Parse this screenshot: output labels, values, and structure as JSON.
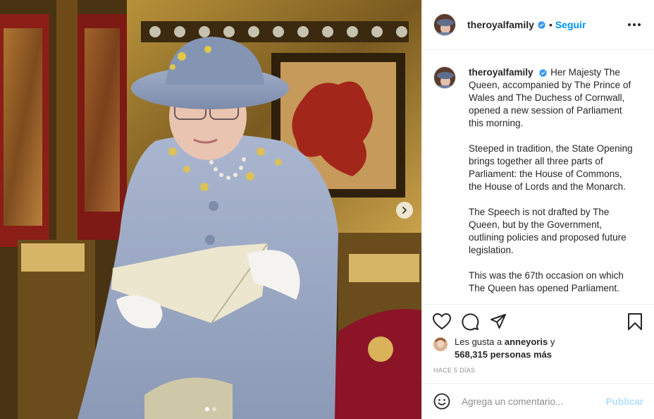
{
  "post": {
    "username": "theroyalfamily",
    "verified": true,
    "follow_label": "Seguir",
    "bullet": "•",
    "more_icon": "ellipsis-icon"
  },
  "caption": {
    "username": "theroyalfamily",
    "paragraphs": [
      "Her Majesty The Queen, accompanied by The Prince of Wales and The Duchess of Cornwall, opened a new session of Parliament this morning.",
      "Steeped in tradition, the State Opening brings together all three parts of Parliament: the House of Commons, the House of Lords and the Monarch.",
      "The Speech is not drafted by The Queen, but by the Government, outlining policies and proposed future legislation.",
      "This was the 67th occasion on which The Queen has opened Parliament."
    ]
  },
  "actions": {
    "like_icon": "heart-icon",
    "comment_icon": "comment-icon",
    "share_icon": "share-icon",
    "save_icon": "bookmark-icon"
  },
  "likes": {
    "prefix": "Les gusta a",
    "liker": "anneyoris",
    "connector": "y",
    "count_text": "568,315 personas más"
  },
  "timestamp": "Hace 5 días",
  "comment": {
    "placeholder": "Agrega un comentario...",
    "publish_label": "Publicar",
    "emoji_icon": "emoji-icon"
  },
  "carousel": {
    "next_icon": "chevron-right-icon",
    "slides": 2,
    "active_index": 0
  },
  "colors": {
    "accent": "#0095f6",
    "verified": "#3897f0",
    "publish_disabled": "#b2dffc",
    "muted": "#8e8e8e"
  }
}
